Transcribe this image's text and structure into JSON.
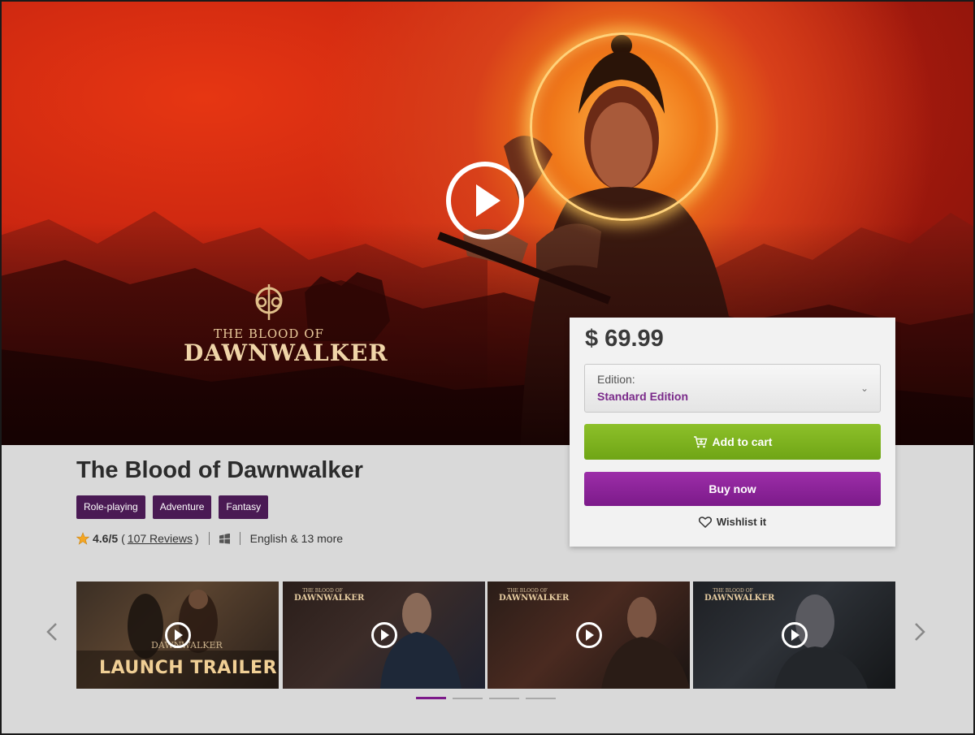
{
  "hero": {
    "logo_line1": "THE BLOOD OF",
    "logo_line2": "DAWNWALKER",
    "play_icon": "play-circle-icon"
  },
  "product": {
    "title": "The Blood of Dawnwalker",
    "tags": [
      "Role-playing",
      "Adventure",
      "Fantasy"
    ],
    "rating": "4.6/5",
    "reviews_open": "(",
    "reviews_link": "107 Reviews",
    "reviews_close": ")",
    "platform_icon": "windows-icon",
    "languages": "English & 13 more"
  },
  "purchase": {
    "price": "$ 69.99",
    "edition_label": "Edition:",
    "edition_value": "Standard Edition",
    "add_to_cart": "Add to cart",
    "buy_now": "Buy now",
    "wishlist": "Wishlist it"
  },
  "carousel": {
    "thumbnails": [
      {
        "overlay_text": "LAUNCH TRAILER",
        "logo_small": "DAWNWALKER"
      },
      {
        "logo_l1": "THE BLOOD OF",
        "logo_l2": "DAWNWALKER"
      },
      {
        "logo_l1": "THE BLOOD OF",
        "logo_l2": "DAWNWALKER"
      },
      {
        "logo_l1": "THE BLOOD OF",
        "logo_l2": "DAWNWALKER"
      }
    ],
    "page_count": 4,
    "active_page": 1
  },
  "colors": {
    "accent_purple": "#7c1a8a",
    "tag_bg": "#4a1a54",
    "cart_green": "#7ab51d",
    "edition_text": "#7a2a8a"
  }
}
